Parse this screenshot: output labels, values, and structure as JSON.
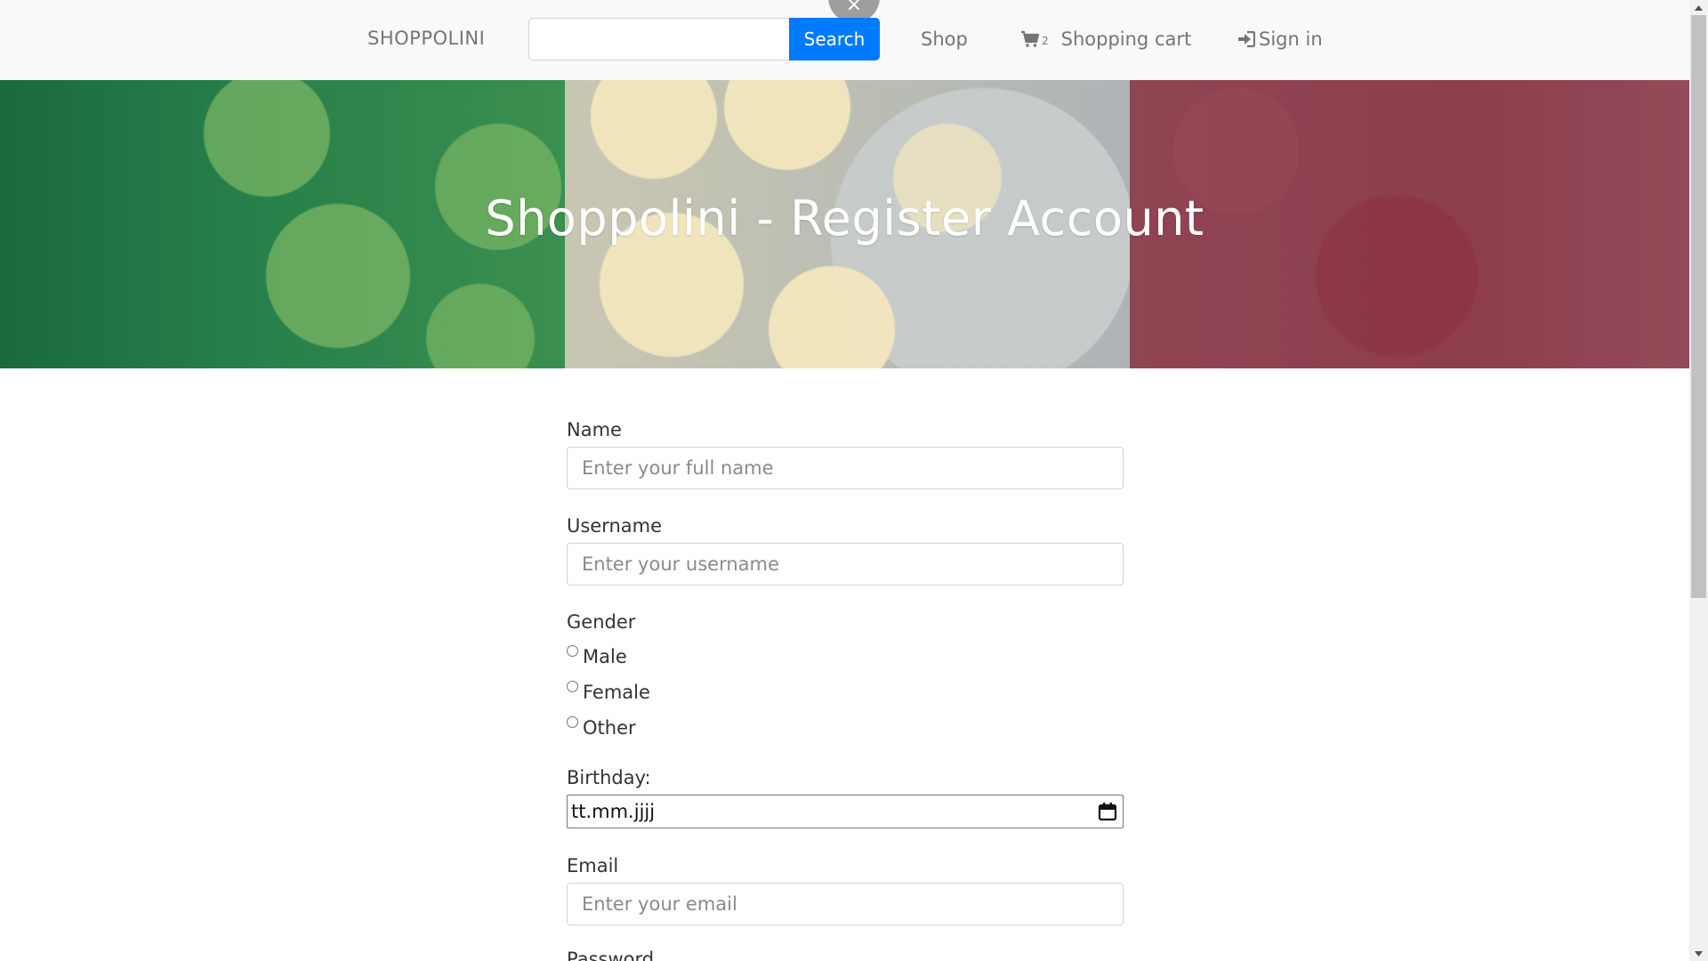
{
  "navbar": {
    "brand": "SHOPPOLINI",
    "search": {
      "value": "",
      "placeholder": "",
      "button_label": "Search"
    },
    "close_label": "×",
    "links": {
      "shop": "Shop",
      "cart_count": "2",
      "cart": "Shopping cart",
      "signin": "Sign in"
    },
    "icons": {
      "cart": "shopping-cart-icon",
      "signin": "sign-in-icon"
    },
    "colors": {
      "background": "#f8f9fa",
      "accent": "#007bff",
      "link": "#757575"
    }
  },
  "hero": {
    "title": "Shoppolini - Register Account",
    "colors": [
      "#1a6a3e",
      "#c9c7b2",
      "#8d3d4c"
    ]
  },
  "form": {
    "name": {
      "label": "Name",
      "placeholder": "Enter your full name",
      "value": ""
    },
    "username": {
      "label": "Username",
      "placeholder": "Enter your username",
      "value": ""
    },
    "gender": {
      "label": "Gender",
      "options": [
        "Male",
        "Female",
        "Other"
      ]
    },
    "birthday": {
      "label": "Birthday:",
      "value": "tt.mm.jjjj",
      "icon": "calendar-icon"
    },
    "email": {
      "label": "Email",
      "placeholder": "Enter your email",
      "value": ""
    },
    "password": {
      "label": "Password"
    }
  }
}
